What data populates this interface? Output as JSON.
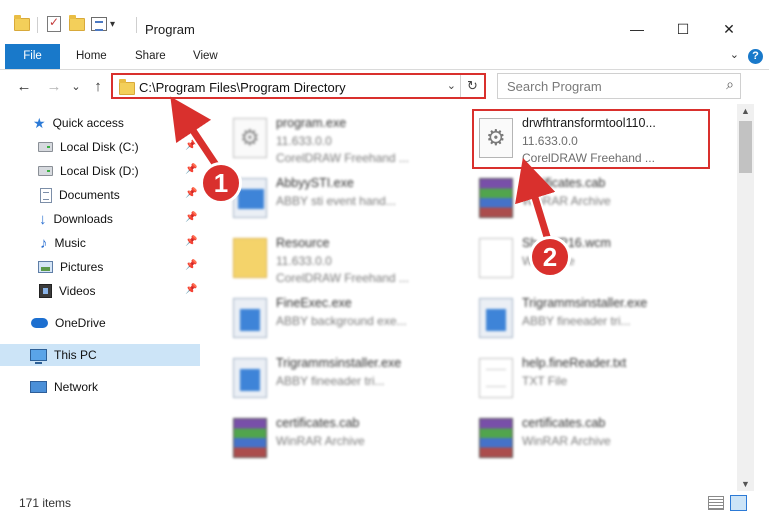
{
  "window": {
    "title": "Program",
    "minimize_glyph": "—",
    "maximize_glyph": "☐",
    "close_glyph": "✕"
  },
  "ribbon": {
    "tabs": [
      "File",
      "Home",
      "Share",
      "View"
    ],
    "help": "?",
    "expand_glyph": "⌄"
  },
  "nav": {
    "back": "←",
    "forward": "→",
    "recent": "⌄",
    "up": "↑",
    "address": "C:\\Program Files\\Program Directory",
    "address_dropdown": "⌄",
    "refresh": "↻",
    "search_placeholder": "Search Program",
    "search_icon": "⌕"
  },
  "sidebar": {
    "pin_glyph": "📌",
    "items": [
      {
        "label": "Quick access",
        "icon": "star-icon",
        "pinned": false
      },
      {
        "label": "Local Disk (C:)",
        "icon": "disk-icon",
        "pinned": true
      },
      {
        "label": "Local Disk (D:)",
        "icon": "disk-icon",
        "pinned": true
      },
      {
        "label": "Documents",
        "icon": "documents-icon",
        "pinned": true
      },
      {
        "label": "Downloads",
        "icon": "downloads-icon",
        "pinned": true
      },
      {
        "label": "Music",
        "icon": "music-icon",
        "pinned": true
      },
      {
        "label": "Pictures",
        "icon": "pictures-icon",
        "pinned": true
      },
      {
        "label": "Videos",
        "icon": "videos-icon",
        "pinned": true
      },
      {
        "label": "OneDrive",
        "icon": "onedrive-icon",
        "pinned": false
      },
      {
        "label": "This PC",
        "icon": "this-pc-icon",
        "pinned": false,
        "selected": true
      },
      {
        "label": "Network",
        "icon": "network-icon",
        "pinned": false
      }
    ]
  },
  "files": [
    {
      "name": "program.exe",
      "line2": "11.633.0.0",
      "line3": "CorelDRAW Freehand ...",
      "icon": "gear-file-icon",
      "blurred": true
    },
    {
      "name": "drwfhtransformtool110...",
      "line2": "11.633.0.0",
      "line3": "CorelDRAW Freehand ...",
      "icon": "gear-file-icon",
      "blurred": false,
      "highlighted": true
    },
    {
      "name": "AbbyySTI.exe",
      "line2": "ABBY sti event hand...",
      "line3": "",
      "icon": "exe-icon",
      "blurred": true
    },
    {
      "name": "certificates.cab",
      "line2": "WinRAR Archive",
      "line3": "",
      "icon": "cab-icon",
      "blurred": true
    },
    {
      "name": "Resource",
      "line2": "11.633.0.0",
      "line3": "CorelDRAW Freehand ...",
      "icon": "folder-icon",
      "blurred": true
    },
    {
      "name": "Sh...WP16.wcm",
      "line2": "WCM File",
      "line3": "",
      "icon": "file-icon",
      "blurred": true
    },
    {
      "name": "FineExec.exe",
      "line2": "ABBY background exe...",
      "line3": "",
      "icon": "exe-icon",
      "blurred": true
    },
    {
      "name": "Trigrammsinstaller.exe",
      "line2": "ABBY fineeader tri...",
      "line3": "",
      "icon": "exe-icon",
      "blurred": true
    },
    {
      "name": "Trigrammsinstaller.exe",
      "line2": "ABBY fineeader tri...",
      "line3": "",
      "icon": "exe-icon",
      "blurred": true
    },
    {
      "name": "help.fineReader.txt",
      "line2": "TXT File",
      "line3": "",
      "icon": "txt-icon",
      "blurred": true
    },
    {
      "name": "certificates.cab",
      "line2": "WinRAR Archive",
      "line3": "",
      "icon": "cab-icon",
      "blurred": true
    },
    {
      "name": "certificates.cab",
      "line2": "WinRAR Archive",
      "line3": "",
      "icon": "cab-icon",
      "blurred": true
    }
  ],
  "scrollbar": {
    "up": "▲",
    "down": "▼"
  },
  "status": {
    "count": "171 items"
  },
  "annotations": {
    "step1": "1",
    "step2": "2",
    "color": "#d9302d"
  }
}
